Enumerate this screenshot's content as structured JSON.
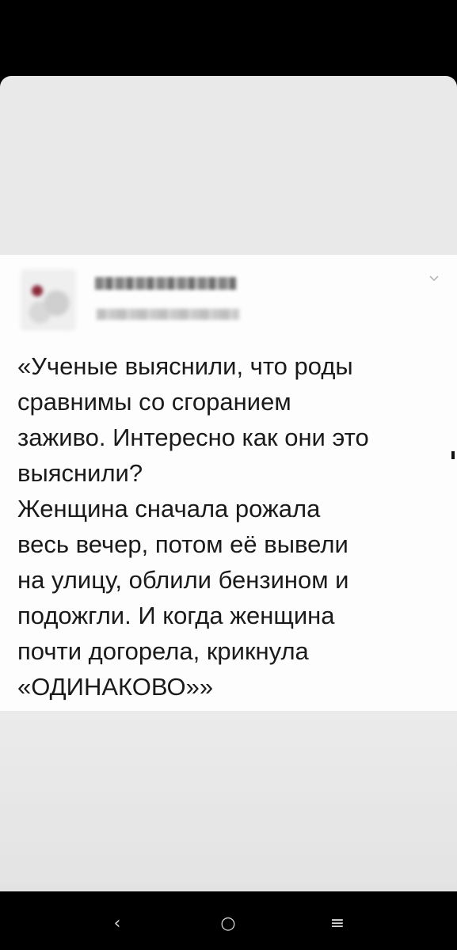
{
  "tweet": {
    "text": "«Ученые выяснили, что роды\nсравнимы со сгоранием\nзаживо. Интересно как они это\nвыяснили?\nЖенщина сначала рожала\nвесь вечер, потом её вывели\nна улицу, облили бензином и\nподожгли. И когда женщина\nпочти догорела, крикнула\n«ОДИНАКОВО»»",
    "menu_icon": "chevron-down-icon"
  },
  "navigation": {
    "back_glyph": "‹",
    "home_glyph": "○",
    "recents_glyph": "≡"
  },
  "colors": {
    "background": "#000000",
    "overlay_grey": "#e9e9e9",
    "card": "#fdfdfd",
    "text": "#1a1a1a"
  }
}
